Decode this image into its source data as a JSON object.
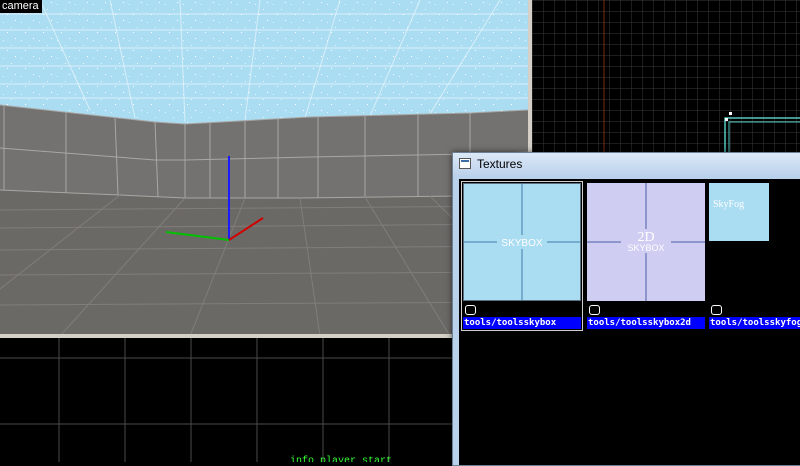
{
  "camera_view": {
    "label": "camera"
  },
  "side_view": {
    "entity_label": "info_player_start"
  },
  "textures_window": {
    "title": "Textures",
    "items": [
      {
        "name": "tools/toolsskybox",
        "thumb_main": "SKYBOX",
        "thumb_top": "",
        "thumb_color": "#aadcf2",
        "selected": true
      },
      {
        "name": "tools/toolsskybox2d",
        "thumb_main": "SKYBOX",
        "thumb_top": "2D",
        "thumb_color": "#cfcdf2",
        "selected": false
      },
      {
        "name": "tools/toolsskyfog",
        "thumb_main": "SkyFog",
        "thumb_top": "",
        "thumb_color": "#aadcf2",
        "selected": false
      }
    ]
  },
  "colors": {
    "accent_blue": "#0000ff",
    "sky": "#aadcf2",
    "floor": "#6b6966",
    "entity_green": "#33ff33"
  }
}
